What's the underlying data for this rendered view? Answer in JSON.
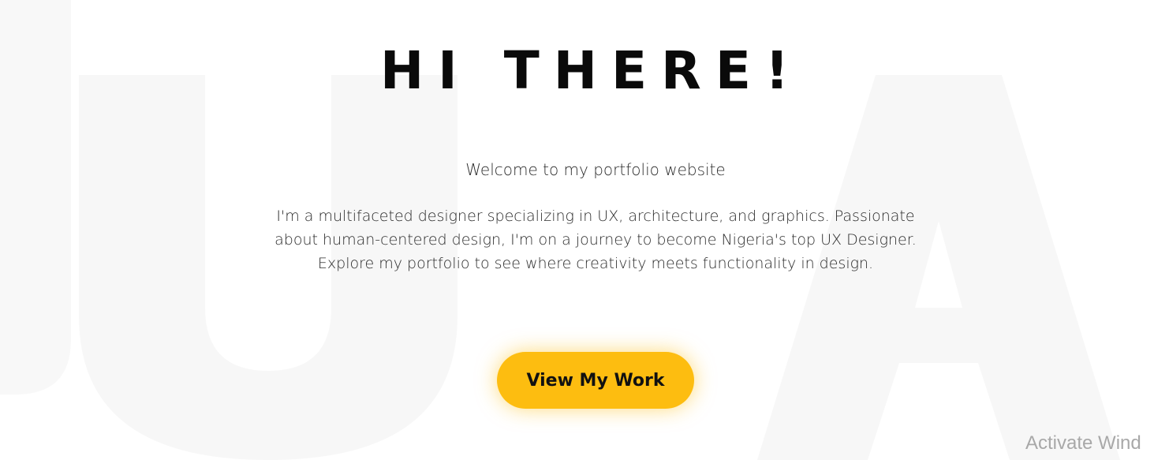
{
  "hero": {
    "title": "HI THERE!",
    "welcome": "Welcome to my portfolio website",
    "about_line_1": "I'm a multifaceted designer specializing in UX, architecture, and graphics. Passionate",
    "about_line_2": "about human-centered design, I'm on a journey to become Nigeria's top UX Designer.",
    "about_line_3": "Explore my portfolio to see where creativity meets functionality in design.",
    "cta_label": "View My Work"
  },
  "overlay": {
    "activate_windows": "Activate Wind"
  },
  "colors": {
    "accent": "#fdbd10",
    "title": "#0a0a0a",
    "body_text": "#2b2b2b",
    "watermark": "#f7f7f7"
  }
}
